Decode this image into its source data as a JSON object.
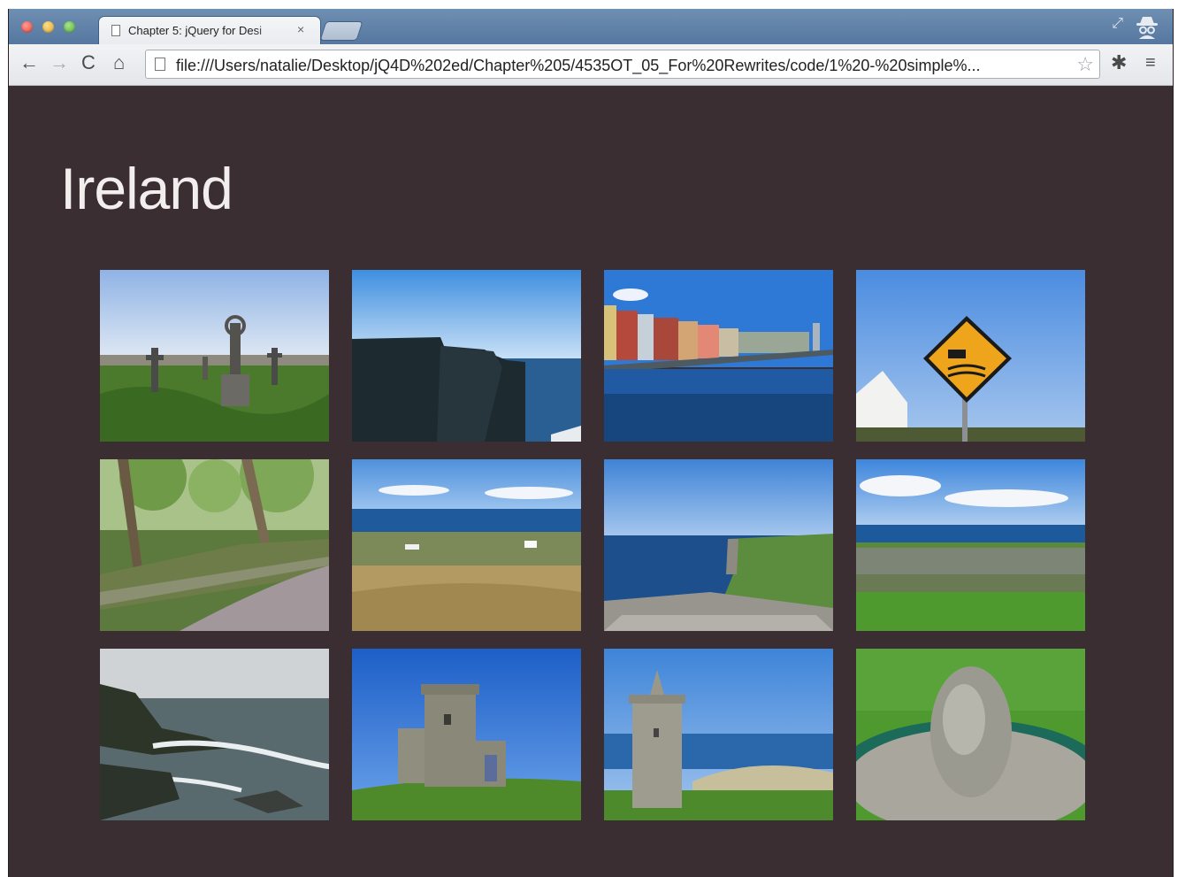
{
  "browser": {
    "tab": {
      "title": "Chapter 5: jQuery for Desi",
      "close_label": "×"
    },
    "address_bar": {
      "url": "file:///Users/natalie/Desktop/jQ4D%202ed/Chapter%205/4535OT_05_For%20Rewrites/code/1%20-%20simple%..."
    },
    "icons": {
      "back": "←",
      "forward": "→",
      "reload": "C",
      "home": "⌂",
      "star": "☆",
      "settings": "✱",
      "menu": "≡",
      "fullscreen": "⤢"
    }
  },
  "page": {
    "title": "Ireland",
    "background_color": "#3b2e33",
    "photos": [
      {
        "subject": "celtic-cross-graveyard"
      },
      {
        "subject": "sea-cliffs"
      },
      {
        "subject": "waterfront-town"
      },
      {
        "subject": "cliff-warning-sign"
      },
      {
        "subject": "wooded-path-stone-wall"
      },
      {
        "subject": "coastal-fields"
      },
      {
        "subject": "cliff-coast"
      },
      {
        "subject": "stone-wall-fields"
      },
      {
        "subject": "rocky-shore-waves"
      },
      {
        "subject": "obriens-tower"
      },
      {
        "subject": "doonagore-castle"
      },
      {
        "subject": "standing-stone"
      }
    ]
  }
}
